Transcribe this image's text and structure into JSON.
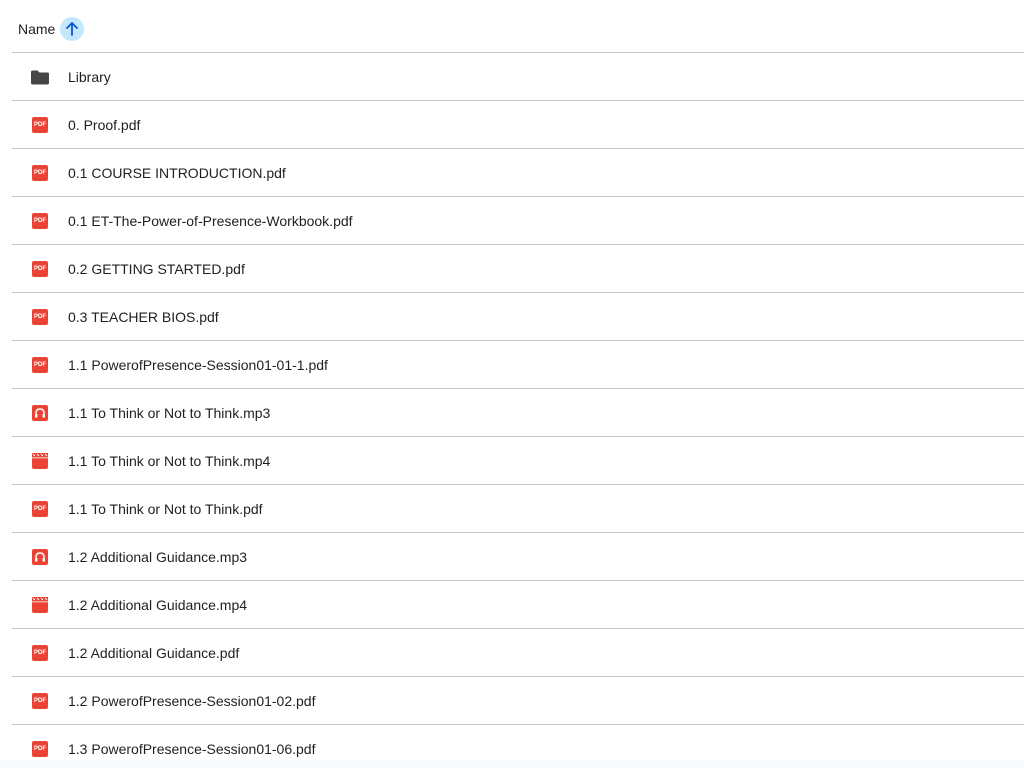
{
  "header": {
    "name_label": "Name",
    "sort_direction": "ascending",
    "sort_icon": "arrow-up-icon"
  },
  "colors": {
    "file_icon_red": "#ea4335",
    "folder_gray": "#444746",
    "sort_button_bg": "#c2e7ff",
    "divider": "#c7c7c7"
  },
  "files": [
    {
      "name": "Library",
      "type": "folder",
      "icon": "folder-icon"
    },
    {
      "name": "0. Proof.pdf",
      "type": "pdf",
      "icon": "pdf-icon"
    },
    {
      "name": "0.1 COURSE INTRODUCTION.pdf",
      "type": "pdf",
      "icon": "pdf-icon"
    },
    {
      "name": "0.1 ET-The-Power-of-Presence-Workbook.pdf",
      "type": "pdf",
      "icon": "pdf-icon"
    },
    {
      "name": "0.2 GETTING STARTED.pdf",
      "type": "pdf",
      "icon": "pdf-icon"
    },
    {
      "name": "0.3 TEACHER BIOS.pdf",
      "type": "pdf",
      "icon": "pdf-icon"
    },
    {
      "name": "1.1 PowerofPresence-Session01-01-1.pdf",
      "type": "pdf",
      "icon": "pdf-icon"
    },
    {
      "name": "1.1 To Think or Not to Think.mp3",
      "type": "audio",
      "icon": "headphones-icon"
    },
    {
      "name": "1.1 To Think or Not to Think.mp4",
      "type": "video",
      "icon": "film-icon"
    },
    {
      "name": "1.1 To Think or Not to Think.pdf",
      "type": "pdf",
      "icon": "pdf-icon"
    },
    {
      "name": "1.2 Additional Guidance.mp3",
      "type": "audio",
      "icon": "headphones-icon"
    },
    {
      "name": "1.2 Additional Guidance.mp4",
      "type": "video",
      "icon": "film-icon"
    },
    {
      "name": "1.2 Additional Guidance.pdf",
      "type": "pdf",
      "icon": "pdf-icon"
    },
    {
      "name": "1.2 PowerofPresence-Session01-02.pdf",
      "type": "pdf",
      "icon": "pdf-icon"
    },
    {
      "name": "1.3 PowerofPresence-Session01-06.pdf",
      "type": "pdf",
      "icon": "pdf-icon"
    }
  ]
}
